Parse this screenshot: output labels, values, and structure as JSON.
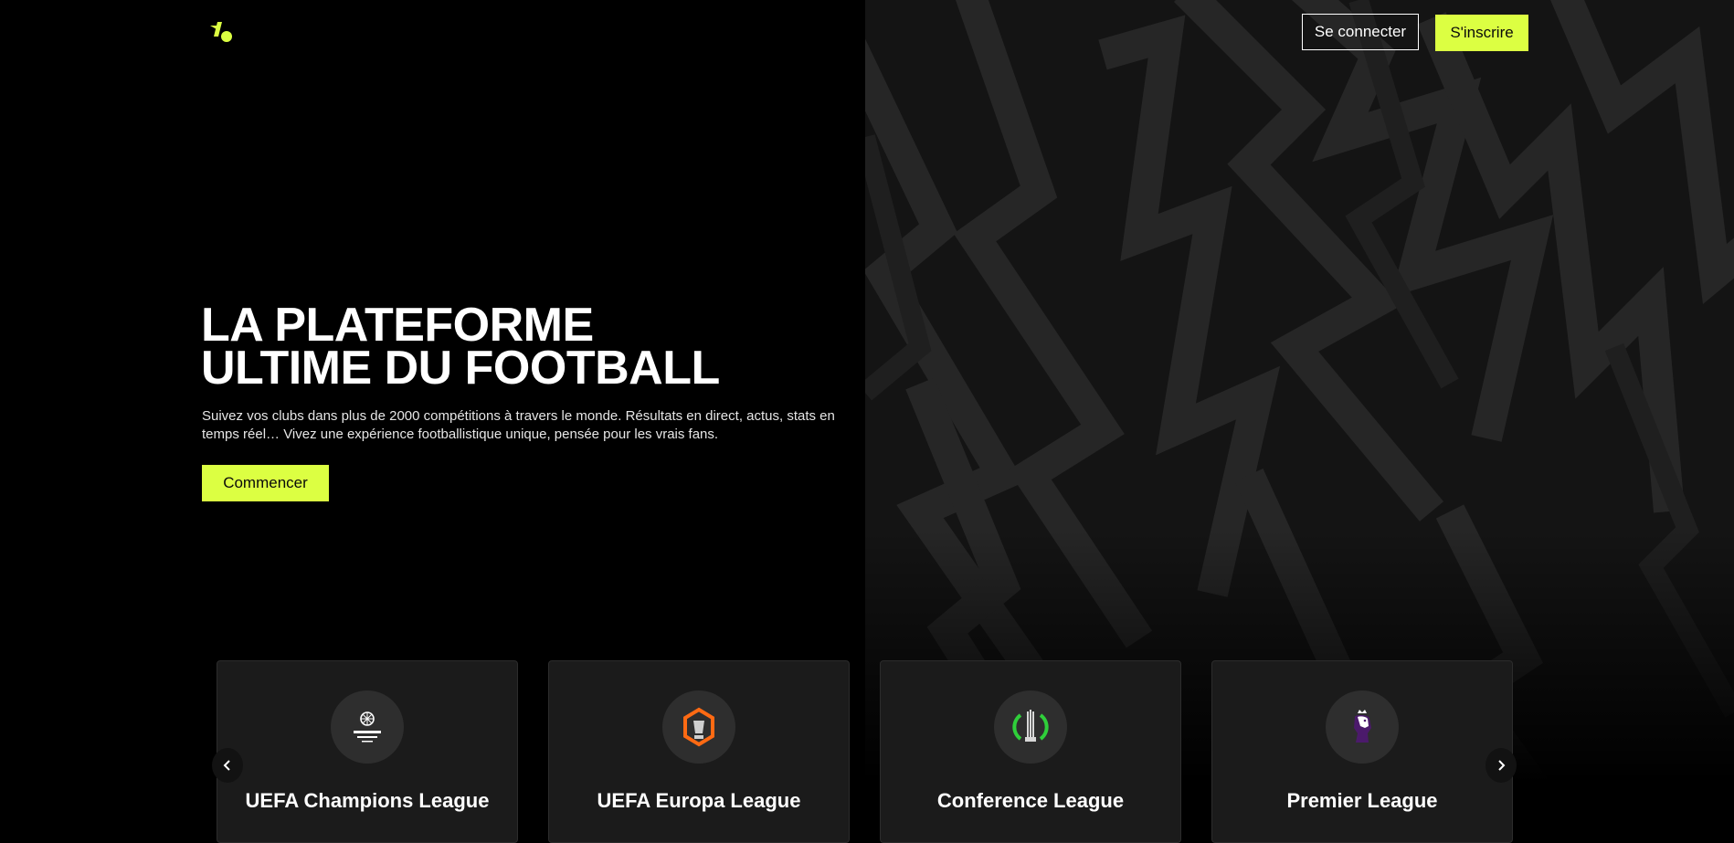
{
  "header": {
    "logo_icon": "brand-logo-icon",
    "login_label": "Se connecter",
    "signup_label": "S'inscrire"
  },
  "hero": {
    "title_line1": "LA PLATEFORME",
    "title_line2": "ULTIME DU FOOTBALL",
    "subtitle": "Suivez vos clubs dans plus de 2000 compétitions à travers le monde. Résultats en direct, actus, stats en temps réel… Vivez une expérience footballistique unique, pensée pour les vrais fans.",
    "cta_label": "Commencer"
  },
  "competitions": [
    {
      "name": "UEFA Champions League",
      "icon": "champions-league-logo-icon"
    },
    {
      "name": "UEFA Europa League",
      "icon": "europa-league-logo-icon"
    },
    {
      "name": "Conference League",
      "icon": "conference-league-logo-icon"
    },
    {
      "name": "Premier League",
      "icon": "premier-league-logo-icon"
    }
  ],
  "carousel": {
    "prev_icon": "chevron-left-icon",
    "next_icon": "chevron-right-icon"
  },
  "colors": {
    "accent": "#dcff42",
    "background": "#000000",
    "card": "#1b1b1b"
  }
}
